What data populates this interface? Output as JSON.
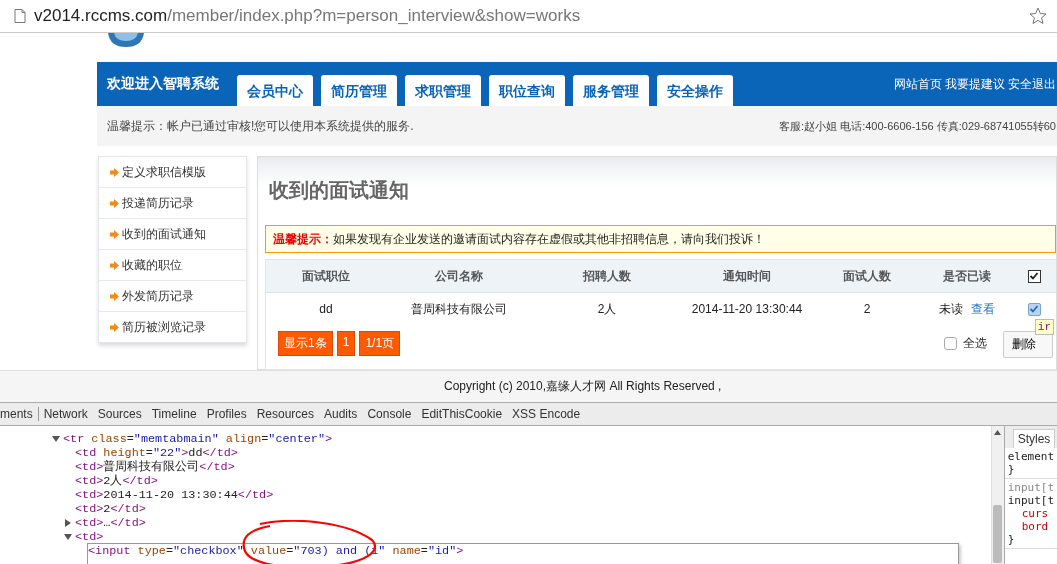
{
  "address_bar": {
    "host": "v2014.rccms.com",
    "path": "/member/index.php?m=person_interview&show=works"
  },
  "nav": {
    "welcome": "欢迎进入智聘系统",
    "tabs": [
      {
        "label": "会员中心",
        "selected": false
      },
      {
        "label": "简历管理",
        "selected": false
      },
      {
        "label": "求职管理",
        "selected": false
      },
      {
        "label": "职位查询",
        "selected": false
      },
      {
        "label": "服务管理",
        "selected": false
      },
      {
        "label": "安全操作",
        "selected": false
      }
    ],
    "links": [
      "网站首页",
      "我要提建议",
      "安全退出"
    ]
  },
  "notice": {
    "text": "温馨提示：帐户已通过审核!您可以使用本系统提供的服务.",
    "contact": "客服:赵小姐 电话:400-6606-156 传真:029-68741055转60"
  },
  "sidebar": {
    "items": [
      "定义求职信模版",
      "投递简历记录",
      "收到的面试通知",
      "收藏的职位",
      "外发简历记录",
      "简历被浏览记录"
    ]
  },
  "main": {
    "title": "收到的面试通知",
    "warning": {
      "label": "温馨提示：",
      "text": "如果发现有企业发送的邀请面试内容存在虚假或其他非招聘信息，请向我们投诉！"
    },
    "table": {
      "columns": [
        {
          "kind": "text",
          "label": "面试职位"
        },
        {
          "kind": "text",
          "label": "公司名称"
        },
        {
          "kind": "text",
          "label": "招聘人数"
        },
        {
          "kind": "text",
          "label": "通知时间"
        },
        {
          "kind": "text",
          "label": "面试人数"
        },
        {
          "kind": "text",
          "label": "是否已读"
        },
        {
          "kind": "checkbox",
          "checked": true
        }
      ],
      "rows": [
        {
          "cells": [
            {
              "kind": "text",
              "text": "dd"
            },
            {
              "kind": "text",
              "text": "普周科技有限公司"
            },
            {
              "kind": "text",
              "text": "2人"
            },
            {
              "kind": "text",
              "text": "2014-11-20 13:30:44"
            },
            {
              "kind": "text",
              "text": "2"
            },
            {
              "kind": "status",
              "text": "未读",
              "link": "查看"
            },
            {
              "kind": "checkbox",
              "checked": true
            }
          ]
        }
      ]
    },
    "pagination": [
      "显示1条",
      "1",
      "1/1页"
    ],
    "select_all": {
      "label": "全选",
      "checked": false
    },
    "delete_button": "删除",
    "tooltip": "ir"
  },
  "footer": "Copyright (c) 2010,嘉缘人才网 All Rights Reserved ,",
  "devtools": {
    "tabs": [
      {
        "label": "ments",
        "selected": true
      },
      {
        "label": "Network",
        "selected": false
      },
      {
        "label": "Sources",
        "selected": false
      },
      {
        "label": "Timeline",
        "selected": false
      },
      {
        "label": "Profiles",
        "selected": false
      },
      {
        "label": "Resources",
        "selected": false
      },
      {
        "label": "Audits",
        "selected": false
      },
      {
        "label": "Console",
        "selected": false
      },
      {
        "label": "EditThisCookie",
        "selected": false
      },
      {
        "label": "XSS Encode",
        "selected": false
      }
    ],
    "tree": [
      {
        "expanded": true,
        "selected": false,
        "tokens": [
          {
            "kind": "tag",
            "text": "<tr"
          },
          {
            "kind": "attr",
            "text": " class"
          },
          {
            "kind": "punct",
            "text": "="
          },
          {
            "kind": "value",
            "text": "\"memtabmain\""
          },
          {
            "kind": "attr",
            "text": " align"
          },
          {
            "kind": "punct",
            "text": "="
          },
          {
            "kind": "value",
            "text": "\"center\""
          },
          {
            "kind": "tag",
            "text": ">"
          }
        ],
        "children": [
          {
            "selected": false,
            "tokens": [
              {
                "kind": "tag",
                "text": "<td"
              },
              {
                "kind": "attr",
                "text": " height"
              },
              {
                "kind": "punct",
                "text": "="
              },
              {
                "kind": "value",
                "text": "\"22\""
              },
              {
                "kind": "tag",
                "text": ">"
              },
              {
                "kind": "text",
                "text": "dd"
              },
              {
                "kind": "tag",
                "text": "</td>"
              }
            ]
          },
          {
            "selected": false,
            "tokens": [
              {
                "kind": "tag",
                "text": "<td>"
              },
              {
                "kind": "text",
                "text": "普周科技有限公司"
              },
              {
                "kind": "tag",
                "text": "</td>"
              }
            ]
          },
          {
            "selected": false,
            "tokens": [
              {
                "kind": "tag",
                "text": "<td>"
              },
              {
                "kind": "text",
                "text": "2人"
              },
              {
                "kind": "tag",
                "text": "</td>"
              }
            ]
          },
          {
            "selected": false,
            "tokens": [
              {
                "kind": "tag",
                "text": "<td>"
              },
              {
                "kind": "text",
                "text": "2014-11-20 13:30:44"
              },
              {
                "kind": "tag",
                "text": "</td>"
              }
            ]
          },
          {
            "selected": false,
            "tokens": [
              {
                "kind": "tag",
                "text": "<td>"
              },
              {
                "kind": "text",
                "text": "2"
              },
              {
                "kind": "tag",
                "text": "</td>"
              }
            ]
          },
          {
            "expanded": false,
            "selected": false,
            "tokens": [
              {
                "kind": "tag",
                "text": "<td>"
              },
              {
                "kind": "text",
                "text": "…"
              },
              {
                "kind": "tag",
                "text": "</td>"
              }
            ]
          },
          {
            "expanded": true,
            "selected": false,
            "tokens": [
              {
                "kind": "tag",
                "text": "<td>"
              }
            ],
            "children": [
              {
                "selected": true,
                "tokens": [
                  {
                    "kind": "tag",
                    "text": "<input"
                  },
                  {
                    "kind": "attr",
                    "text": " type"
                  },
                  {
                    "kind": "punct",
                    "text": "="
                  },
                  {
                    "kind": "value",
                    "text": "\"checkbox\""
                  },
                  {
                    "kind": "attr",
                    "text": " value"
                  },
                  {
                    "kind": "punct",
                    "text": "="
                  },
                  {
                    "kind": "value",
                    "text": "\"703) and (1\""
                  },
                  {
                    "kind": "attr",
                    "text": " name"
                  },
                  {
                    "kind": "punct",
                    "text": "="
                  },
                  {
                    "kind": "value",
                    "text": "\"id\""
                  },
                  {
                    "kind": "tag",
                    "text": ">"
                  }
                ]
              }
            ]
          }
        ]
      }
    ],
    "styles_tab": "Styles",
    "rules": [
      {
        "lines": [
          {
            "kind": "selector",
            "text": "element"
          },
          {
            "kind": "brace",
            "text": "}"
          }
        ]
      },
      {
        "lines": [
          {
            "kind": "inactive",
            "text": "input[t"
          },
          {
            "kind": "selector",
            "text": "input[t"
          },
          {
            "kind": "property",
            "text": "curs"
          },
          {
            "kind": "property",
            "text": "bord"
          },
          {
            "kind": "brace",
            "text": "}"
          }
        ]
      }
    ]
  }
}
